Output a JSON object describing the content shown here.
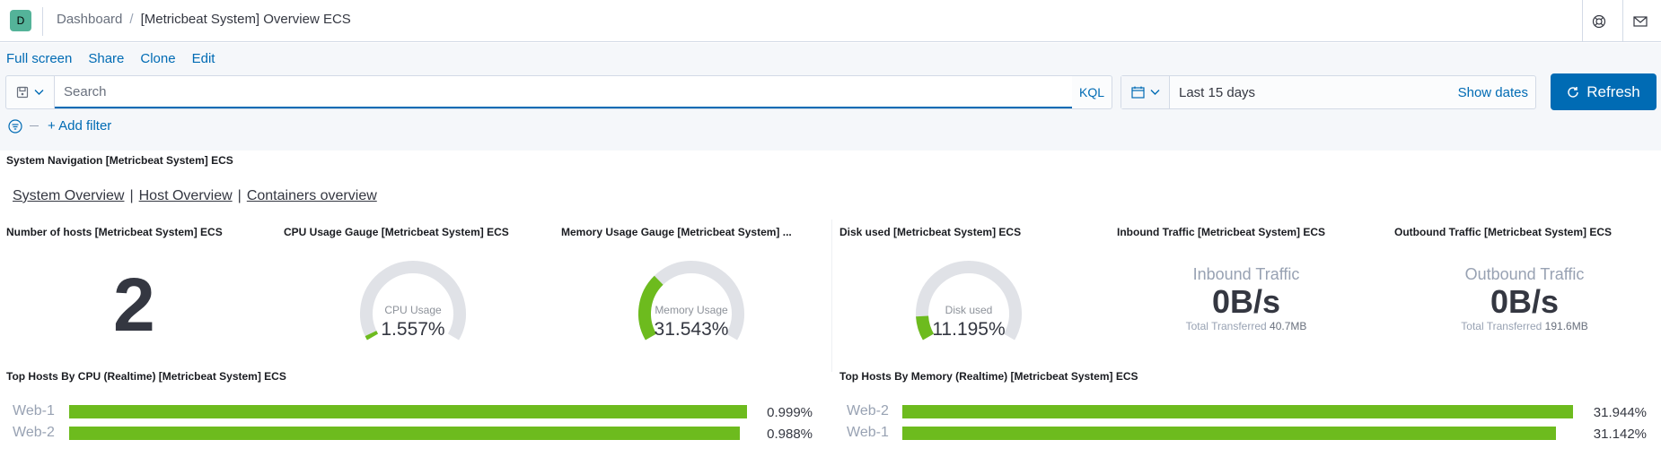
{
  "header": {
    "avatar_letter": "D",
    "breadcrumb_root": "Dashboard",
    "breadcrumb_sep": "/",
    "breadcrumb_current": "[Metricbeat System] Overview ECS"
  },
  "topnav": {
    "full_screen": "Full screen",
    "share": "Share",
    "clone": "Clone",
    "edit": "Edit"
  },
  "query": {
    "placeholder": "Search",
    "value": "",
    "language": "KQL"
  },
  "time": {
    "range": "Last 15 days",
    "show_dates": "Show dates",
    "refresh": "Refresh"
  },
  "filter": {
    "add_filter": "+ Add filter"
  },
  "panels": {
    "navigation": {
      "title": "System Navigation [Metricbeat System] ECS",
      "links": [
        "System Overview",
        "Host Overview",
        "Containers overview"
      ],
      "separator": "|"
    },
    "hosts": {
      "title": "Number of hosts [Metricbeat System] ECS",
      "value": "2"
    },
    "cpu_gauge": {
      "title": "CPU Usage Gauge [Metricbeat System] ECS",
      "label": "CPU Usage",
      "value": "1.557%",
      "fraction": 0.01557
    },
    "memory_gauge": {
      "title": "Memory Usage Gauge [Metricbeat System] ...",
      "label": "Memory Usage",
      "value": "31.543%",
      "fraction": 0.31543
    },
    "disk_gauge": {
      "title": "Disk used [Metricbeat System] ECS",
      "label": "Disk used",
      "value": "11.195%",
      "fraction": 0.11195
    },
    "inbound": {
      "title": "Inbound Traffic [Metricbeat System] ECS",
      "label": "Inbound Traffic",
      "value": "0B/s",
      "total_label": "Total Transferred",
      "total_value": "40.7MB"
    },
    "outbound": {
      "title": "Outbound Traffic [Metricbeat System] ECS",
      "label": "Outbound Traffic",
      "value": "0B/s",
      "total_label": "Total Transferred",
      "total_value": "191.6MB"
    },
    "top_cpu": {
      "title": "Top Hosts By CPU (Realtime) [Metricbeat System] ECS",
      "rows": [
        {
          "name": "Web-1",
          "value": "0.999%",
          "fraction": 1.0
        },
        {
          "name": "Web-2",
          "value": "0.988%",
          "fraction": 0.989
        }
      ]
    },
    "top_memory": {
      "title": "Top Hosts By Memory (Realtime) [Metricbeat System] ECS",
      "rows": [
        {
          "name": "Web-2",
          "value": "31.944%",
          "fraction": 1.0
        },
        {
          "name": "Web-1",
          "value": "31.142%",
          "fraction": 0.975
        }
      ]
    }
  },
  "colors": {
    "accent": "#006bb4",
    "gauge_fill": "#6dbb1e",
    "gauge_track": "#e0e2e7",
    "bar": "#6dbb1e"
  }
}
